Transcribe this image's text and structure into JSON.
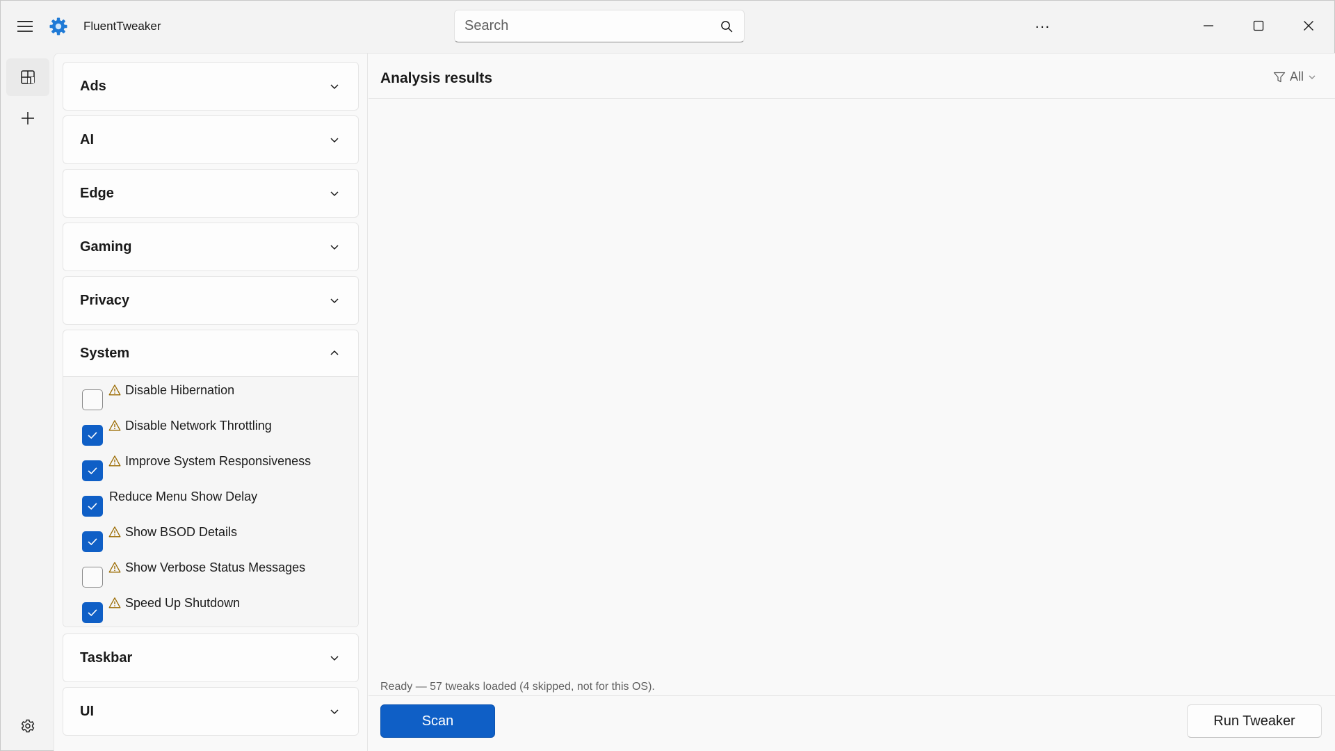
{
  "app": {
    "title": "FluentTweaker",
    "accent": "#0f5fc6"
  },
  "titlebar": {
    "search_placeholder": "Search",
    "more_label": "···"
  },
  "categories": [
    {
      "label": "Ads",
      "expanded": false
    },
    {
      "label": "AI",
      "expanded": false
    },
    {
      "label": "Edge",
      "expanded": false
    },
    {
      "label": "Gaming",
      "expanded": false
    },
    {
      "label": "Privacy",
      "expanded": false
    },
    {
      "label": "System",
      "expanded": true
    },
    {
      "label": "Taskbar",
      "expanded": false
    },
    {
      "label": "UI",
      "expanded": false
    }
  ],
  "system_tweaks": [
    {
      "label": "Disable Hibernation",
      "checked": false,
      "warning": true
    },
    {
      "label": "Disable Network Throttling",
      "checked": true,
      "warning": true
    },
    {
      "label": "Improve System Responsiveness",
      "checked": true,
      "warning": true
    },
    {
      "label": "Reduce Menu Show Delay",
      "checked": true,
      "warning": false
    },
    {
      "label": "Show BSOD Details",
      "checked": true,
      "warning": true
    },
    {
      "label": "Show Verbose Status Messages",
      "checked": false,
      "warning": true
    },
    {
      "label": "Speed Up Shutdown",
      "checked": true,
      "warning": true
    }
  ],
  "results": {
    "title": "Analysis results",
    "filter_label": "All"
  },
  "status": "Ready — 57 tweaks loaded (4 skipped, not for this OS).",
  "actions": {
    "scan_label": "Scan",
    "run_label": "Run Tweaker"
  }
}
